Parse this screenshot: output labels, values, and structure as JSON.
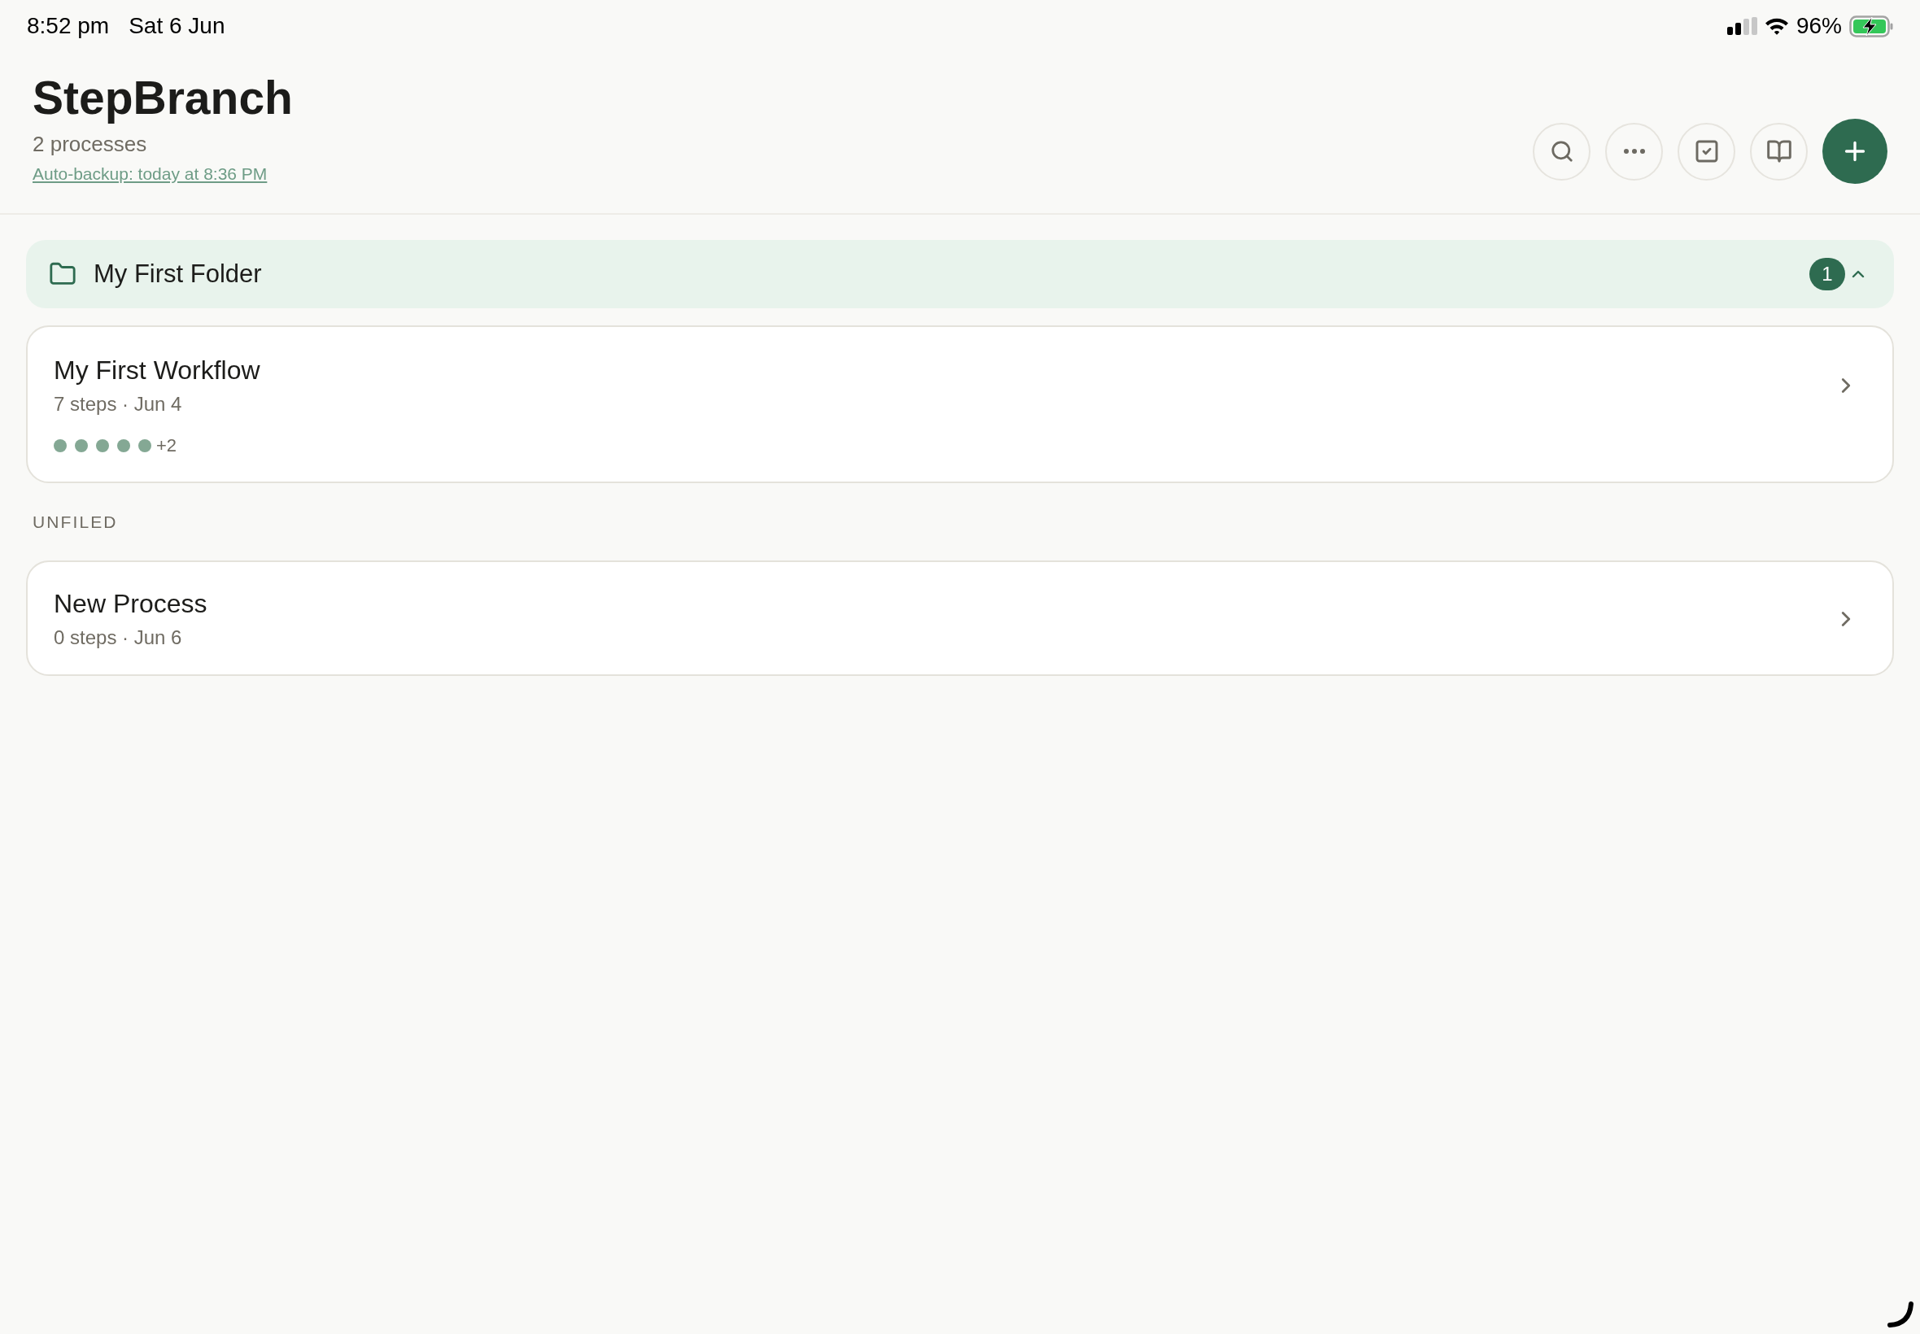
{
  "status_bar": {
    "time": "8:52 pm",
    "date": "Sat 6 Jun",
    "battery": "96%"
  },
  "header": {
    "title": "StepBranch",
    "count": "2 processes",
    "backup_link": "Auto-backup: today at 8:36 PM"
  },
  "folders": [
    {
      "name": "My First Folder",
      "count": "1",
      "expanded": true,
      "processes": [
        {
          "title": "My First Workflow",
          "meta": "7 steps · Jun 4",
          "step_dots": [
            {
              "color": "#84a894"
            },
            {
              "color": "#84a894"
            },
            {
              "color": "#84a894"
            },
            {
              "color": "#84a894"
            },
            {
              "color": "#84a894"
            }
          ],
          "more_steps": "+2"
        }
      ]
    }
  ],
  "unfiled": {
    "heading": "UNFILED",
    "processes": [
      {
        "title": "New Process",
        "meta": "0 steps · Jun 6"
      }
    ]
  }
}
